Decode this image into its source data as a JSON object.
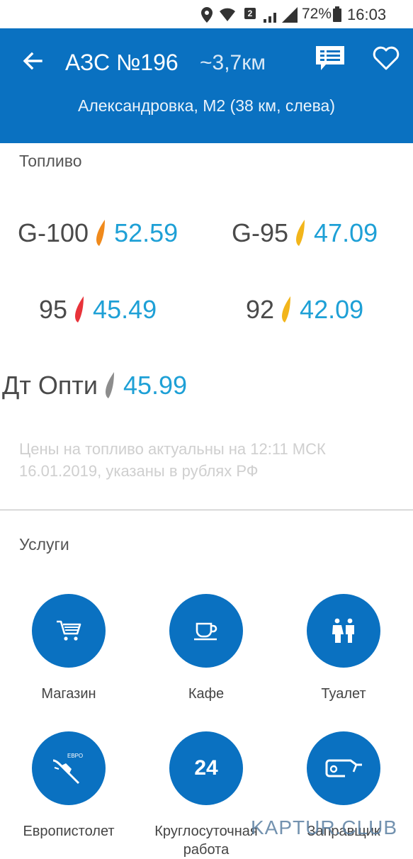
{
  "status_bar": {
    "battery": "72%",
    "time": "16:03",
    "notification_badge": "2"
  },
  "header": {
    "title": "АЗС №196",
    "distance": "~3,7км",
    "address": "Александровка, М2 (38 км, слева)",
    "icons": [
      "back-arrow-icon",
      "reviews-icon",
      "favorite-heart-icon"
    ]
  },
  "fuel_section": {
    "label": "Топливо",
    "items": [
      {
        "name": "G-100",
        "price": "52.59",
        "drop_color": "#f08a1c"
      },
      {
        "name": "G-95",
        "price": "47.09",
        "drop_color": "#f2b51b"
      },
      {
        "name": "95",
        "price": "45.49",
        "drop_color": "#e8333a"
      },
      {
        "name": "92",
        "price": "42.09",
        "drop_color": "#f2b51b"
      },
      {
        "name": "Дт Опти",
        "price": "45.99",
        "drop_color": "#8d8d8d"
      }
    ],
    "note": "Цены на топливо актуальны на 12:11 МСК 16.01.2019, указаны в рублях РФ"
  },
  "services_section": {
    "label": "Услуги",
    "items": [
      {
        "label": "Магазин",
        "icon": "shopping-cart-icon"
      },
      {
        "label": "Кафе",
        "icon": "coffee-cup-icon"
      },
      {
        "label": "Туалет",
        "icon": "toilet-icon"
      },
      {
        "label": "Европистолет",
        "icon": "euro-nozzle-icon",
        "icon_text": "ЕВРО"
      },
      {
        "label": "Круглосуточная работа",
        "icon": "24-hours-icon",
        "icon_text": "24"
      },
      {
        "label": "Заправщик",
        "icon": "fuel-nozzle-icon"
      }
    ]
  },
  "watermark": "KAPTUR.CLUB",
  "colors": {
    "primary": "#0a71c1",
    "price": "#1ea0d6"
  }
}
